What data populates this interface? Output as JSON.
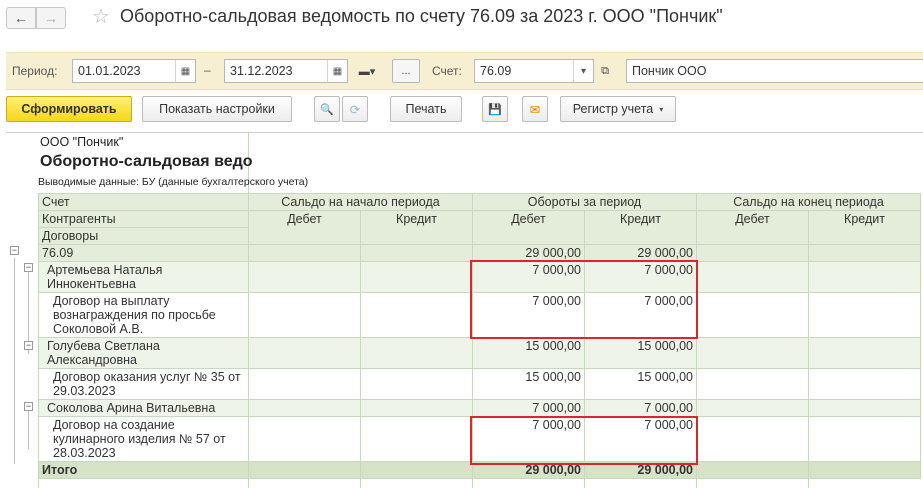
{
  "window": {
    "title": "Оборотно-сальдовая ведомость по счету 76.09 за 2023 г. ООО \"Пончик\"",
    "back_glyph": "←",
    "forward_glyph": "→",
    "favorite_glyph": "☆"
  },
  "params": {
    "period_label": "Период:",
    "date_from": "01.01.2023",
    "dash": "–",
    "date_to": "31.12.2023",
    "period_menu_glyph": "▬▾",
    "more_label": "...",
    "account_label": "Счет:",
    "account_value": "76.09",
    "organization_value": "Пончик ООО",
    "calendar_glyph": "▦",
    "dropdown_glyph": "▾",
    "open_glyph": "⧉"
  },
  "toolbar": {
    "generate_label": "Сформировать",
    "settings_label": "Показать настройки",
    "search_glyph": "🔍",
    "search_cancel_glyph": "⟳",
    "print_label": "Печать",
    "save_glyph": "💾",
    "mail_glyph": "✉",
    "register_label": "Регистр учета",
    "caret_glyph": "▾"
  },
  "report": {
    "org": "ООО \"Пончик\"",
    "heading": "Оборотно-сальдовая ведо",
    "output_note": "Выводимые данные:  БУ (данные бухгалтерского учета)",
    "headers": {
      "account": "Счет",
      "counterparties": "Контрагенты",
      "contracts": "Договоры",
      "opening_balance": "Сальдо на начало периода",
      "turnover": "Обороты за период",
      "closing_balance": "Сальдо на конец периода",
      "debit": "Дебет",
      "credit": "Кредит"
    },
    "account_row": {
      "name": "76.09",
      "turnover_debit": "29 000,00",
      "turnover_credit": "29 000,00"
    },
    "rows": [
      {
        "counterparty": "Артемьева Наталья Иннокентьевна",
        "turnover_debit": "7 000,00",
        "turnover_credit": "7 000,00",
        "contract": "Договор на выплату вознаграждения по просьбе Соколовой А.В.",
        "contract_debit": "7 000,00",
        "contract_credit": "7 000,00"
      },
      {
        "counterparty": "Голубева Светлана Александровна",
        "turnover_debit": "15 000,00",
        "turnover_credit": "15 000,00",
        "contract": "Договор оказания услуг № 35 от 29.03.2023",
        "contract_debit": "15 000,00",
        "contract_credit": "15 000,00"
      },
      {
        "counterparty": "Соколова Арина Витальевна",
        "turnover_debit": "7 000,00",
        "turnover_credit": "7 000,00",
        "contract": "Договор на создание кулинарного изделия № 57 от 28.03.2023",
        "contract_debit": "7 000,00",
        "contract_credit": "7 000,00"
      }
    ],
    "total": {
      "label": "Итого",
      "turnover_debit": "29 000,00",
      "turnover_credit": "29 000,00"
    },
    "collapse_glyph": "−",
    "highlight_color": "#d9272e"
  }
}
